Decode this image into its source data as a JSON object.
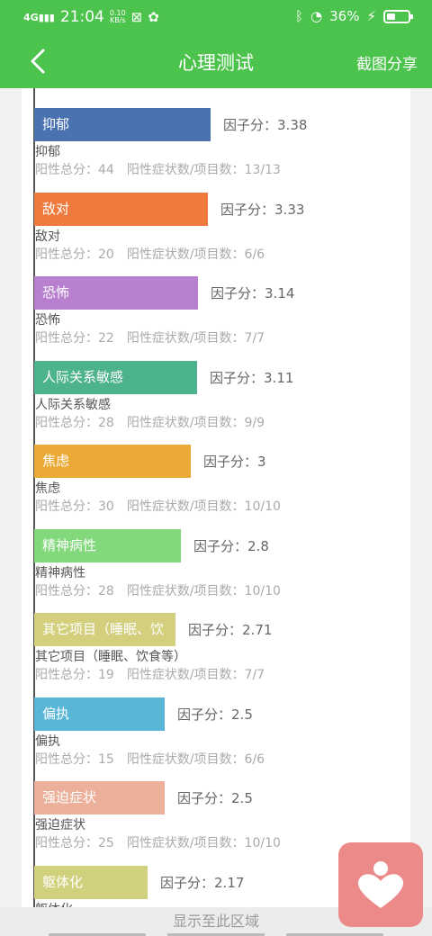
{
  "status_bar": {
    "network": "4G",
    "time": "21:04",
    "speed_value": "0.10",
    "speed_unit": "KB/s",
    "battery": "36%"
  },
  "nav": {
    "title": "心理测试",
    "share_label": "截图分享"
  },
  "chart_data": {
    "type": "bar",
    "score_label": "因子分：",
    "positive_total_label": "阳性总分：",
    "positive_count_label": "阳性症状数/项目数：",
    "items": [
      {
        "bar_label": "抑郁",
        "name": "抑郁",
        "score": 3.38,
        "score_text": "3.38",
        "positive_total": "44",
        "positive_ratio": "13/13",
        "color": "#4a72b0"
      },
      {
        "bar_label": "敌对",
        "name": "敌对",
        "score": 3.33,
        "score_text": "3.33",
        "positive_total": "20",
        "positive_ratio": "6/6",
        "color": "#ee7a3e"
      },
      {
        "bar_label": "恐怖",
        "name": "恐怖",
        "score": 3.14,
        "score_text": "3.14",
        "positive_total": "22",
        "positive_ratio": "7/7",
        "color": "#b77fce"
      },
      {
        "bar_label": "人际关系敏感",
        "name": "人际关系敏感",
        "score": 3.11,
        "score_text": "3.11",
        "positive_total": "28",
        "positive_ratio": "9/9",
        "color": "#4db38d"
      },
      {
        "bar_label": "焦虑",
        "name": "焦虑",
        "score": 3.0,
        "score_text": "3",
        "positive_total": "30",
        "positive_ratio": "10/10",
        "color": "#ebaa35"
      },
      {
        "bar_label": "精神病性",
        "name": "精神病性",
        "score": 2.8,
        "score_text": "2.8",
        "positive_total": "28",
        "positive_ratio": "10/10",
        "color": "#82d97c"
      },
      {
        "bar_label": "其它项目（睡眠、饮",
        "name": "其它项目（睡眠、饮食等）",
        "score": 2.71,
        "score_text": "2.71",
        "positive_total": "19",
        "positive_ratio": "7/7",
        "color": "#d3cf7d"
      },
      {
        "bar_label": "偏执",
        "name": "偏执",
        "score": 2.5,
        "score_text": "2.5",
        "positive_total": "15",
        "positive_ratio": "6/6",
        "color": "#5ab6d7"
      },
      {
        "bar_label": "强迫症状",
        "name": "强迫症状",
        "score": 2.5,
        "score_text": "2.5",
        "positive_total": "25",
        "positive_ratio": "10/10",
        "color": "#ecb09a"
      },
      {
        "bar_label": "躯体化",
        "name": "躯体化",
        "score": 2.17,
        "score_text": "2.17",
        "positive_total": "",
        "positive_ratio": "",
        "color": "#d1d07d"
      }
    ]
  },
  "footer": {
    "label": "显示至此区域"
  }
}
